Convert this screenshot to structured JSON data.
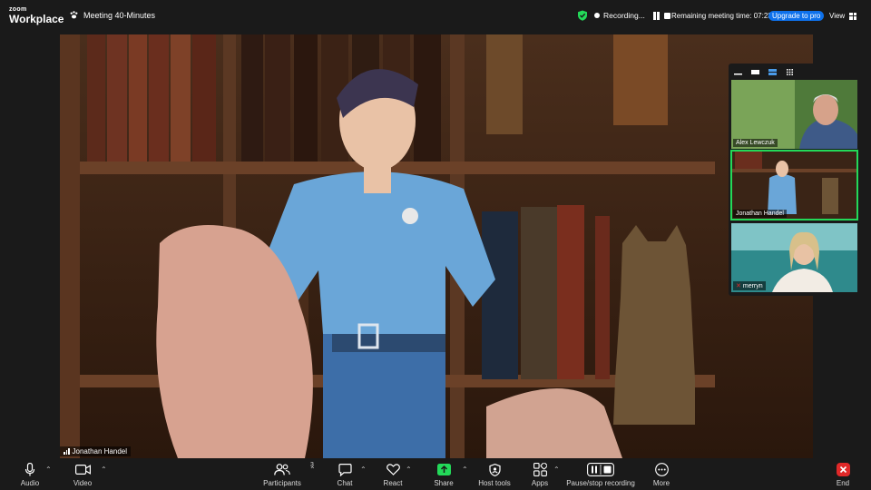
{
  "app": {
    "logo_top": "zoom",
    "logo_bottom": "Workplace"
  },
  "meeting": {
    "title": "Meeting 40-Minutes",
    "recording_label": "Recording...",
    "remaining": "Remaining meeting time: 07:23",
    "upgrade_label": "Upgrade to pro",
    "view_label": "View"
  },
  "main_video": {
    "speaker_name": "Jonathan Handel"
  },
  "gallery": {
    "participants": [
      {
        "name": "Alex Lewczuk",
        "muted": false,
        "active": false
      },
      {
        "name": "Jonathan Handel",
        "muted": false,
        "active": true
      },
      {
        "name": "merryn",
        "muted": true,
        "active": false
      }
    ]
  },
  "toolbar": {
    "audio": "Audio",
    "video": "Video",
    "participants": "Participants",
    "participants_count": "3",
    "chat": "Chat",
    "react": "React",
    "share": "Share",
    "host_tools": "Host tools",
    "apps": "Apps",
    "pause_stop": "Pause/stop recording",
    "more": "More",
    "end": "End"
  },
  "colors": {
    "share_green": "#23d959",
    "end_red": "#e02828",
    "upgrade_blue": "#0e71eb",
    "active_tile": "#23d959"
  }
}
